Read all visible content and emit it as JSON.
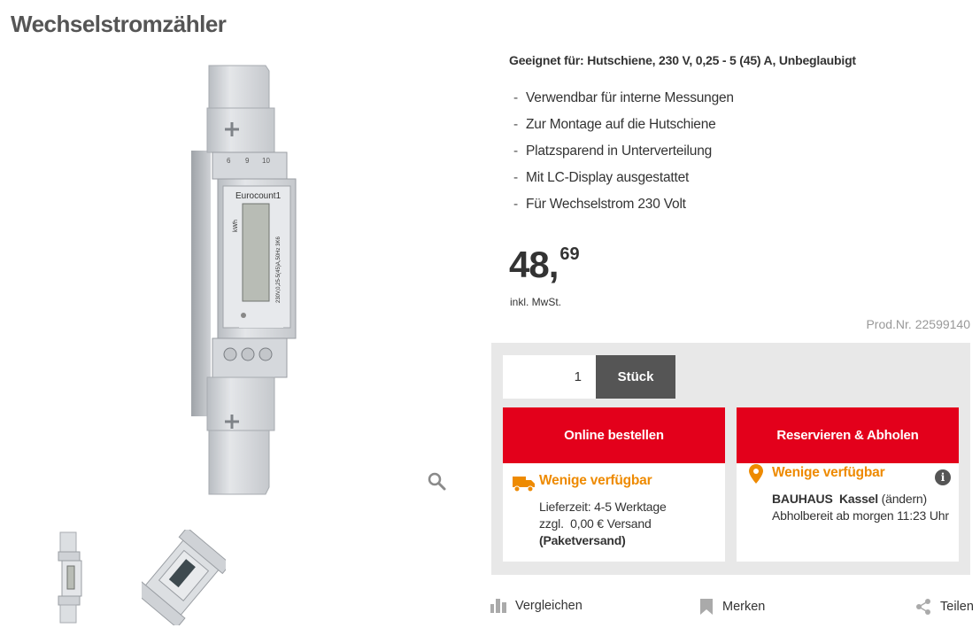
{
  "product": {
    "title": "Wechselstromzähler",
    "image_text": {
      "brand": "Eurocount1",
      "unit": "kWh",
      "spec": "230V,0,25-5(45)A,50Hz 3K6"
    }
  },
  "details": {
    "suitable_for": "Geeignet für: Hutschiene, 230 V, 0,25 - 5 (45) A, Unbeglaubigt",
    "features": [
      "Verwendbar für interne Messungen",
      "Zur Montage auf die Hutschiene",
      "Platzsparend in Unterverteilung",
      "Mit LC-Display ausgestattet",
      "Für Wechselstrom 230 Volt"
    ],
    "feature_bullet": "-"
  },
  "price": {
    "main": "48,",
    "cents": "69",
    "vat_note": "inkl. MwSt."
  },
  "product_number": "Prod.Nr. 22599140",
  "order": {
    "quantity": "1",
    "unit_label": "Stück",
    "online": {
      "button_label": "Online bestellen",
      "availability": "Wenige verfügbar",
      "delivery_time": "Lieferzeit: 4-5 Werktage",
      "shipping_cost": "zzgl.  0,00 € Versand",
      "shipping_type": "(Paketversand)"
    },
    "reserve": {
      "button_label": "Reservieren & Abholen",
      "availability": "Wenige verfügbar",
      "store_brand": "BAUHAUS",
      "store_city": "Kassel",
      "change_link": "(ändern)",
      "pickup": "Abholbereit ab morgen 11:23 Uhr",
      "info_glyph": "i"
    }
  },
  "actions": {
    "compare": "Vergleichen",
    "remember": "Merken",
    "share": "Teilen"
  },
  "colors": {
    "brand_red": "#e3001b",
    "availability_orange": "#ee8a00",
    "dark_gray": "#555555",
    "panel_gray": "#e8e8e8"
  },
  "icons": [
    "zoom-icon",
    "truck-icon",
    "location-pin-icon",
    "info-icon",
    "compare-icon",
    "bookmark-icon",
    "share-icon"
  ]
}
